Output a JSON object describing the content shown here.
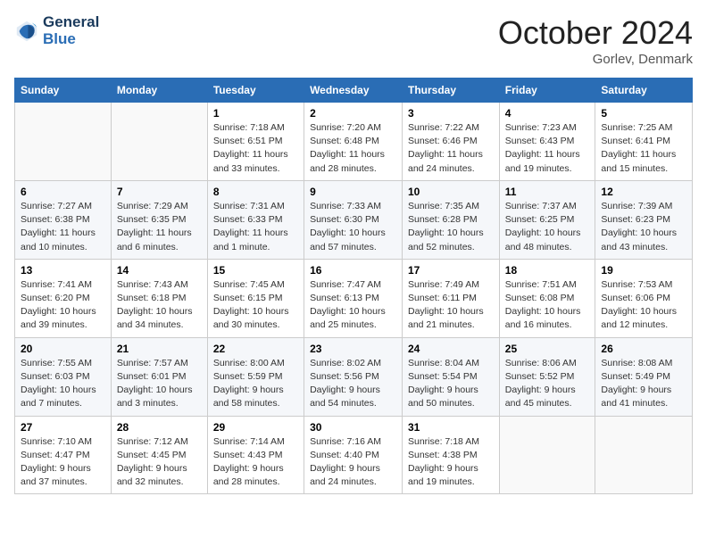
{
  "logo": {
    "line1": "General",
    "line2": "Blue"
  },
  "title": "October 2024",
  "location": "Gorlev, Denmark",
  "days_of_week": [
    "Sunday",
    "Monday",
    "Tuesday",
    "Wednesday",
    "Thursday",
    "Friday",
    "Saturday"
  ],
  "weeks": [
    [
      {
        "num": "",
        "detail": ""
      },
      {
        "num": "",
        "detail": ""
      },
      {
        "num": "1",
        "detail": "Sunrise: 7:18 AM\nSunset: 6:51 PM\nDaylight: 11 hours\nand 33 minutes."
      },
      {
        "num": "2",
        "detail": "Sunrise: 7:20 AM\nSunset: 6:48 PM\nDaylight: 11 hours\nand 28 minutes."
      },
      {
        "num": "3",
        "detail": "Sunrise: 7:22 AM\nSunset: 6:46 PM\nDaylight: 11 hours\nand 24 minutes."
      },
      {
        "num": "4",
        "detail": "Sunrise: 7:23 AM\nSunset: 6:43 PM\nDaylight: 11 hours\nand 19 minutes."
      },
      {
        "num": "5",
        "detail": "Sunrise: 7:25 AM\nSunset: 6:41 PM\nDaylight: 11 hours\nand 15 minutes."
      }
    ],
    [
      {
        "num": "6",
        "detail": "Sunrise: 7:27 AM\nSunset: 6:38 PM\nDaylight: 11 hours\nand 10 minutes."
      },
      {
        "num": "7",
        "detail": "Sunrise: 7:29 AM\nSunset: 6:35 PM\nDaylight: 11 hours\nand 6 minutes."
      },
      {
        "num": "8",
        "detail": "Sunrise: 7:31 AM\nSunset: 6:33 PM\nDaylight: 11 hours\nand 1 minute."
      },
      {
        "num": "9",
        "detail": "Sunrise: 7:33 AM\nSunset: 6:30 PM\nDaylight: 10 hours\nand 57 minutes."
      },
      {
        "num": "10",
        "detail": "Sunrise: 7:35 AM\nSunset: 6:28 PM\nDaylight: 10 hours\nand 52 minutes."
      },
      {
        "num": "11",
        "detail": "Sunrise: 7:37 AM\nSunset: 6:25 PM\nDaylight: 10 hours\nand 48 minutes."
      },
      {
        "num": "12",
        "detail": "Sunrise: 7:39 AM\nSunset: 6:23 PM\nDaylight: 10 hours\nand 43 minutes."
      }
    ],
    [
      {
        "num": "13",
        "detail": "Sunrise: 7:41 AM\nSunset: 6:20 PM\nDaylight: 10 hours\nand 39 minutes."
      },
      {
        "num": "14",
        "detail": "Sunrise: 7:43 AM\nSunset: 6:18 PM\nDaylight: 10 hours\nand 34 minutes."
      },
      {
        "num": "15",
        "detail": "Sunrise: 7:45 AM\nSunset: 6:15 PM\nDaylight: 10 hours\nand 30 minutes."
      },
      {
        "num": "16",
        "detail": "Sunrise: 7:47 AM\nSunset: 6:13 PM\nDaylight: 10 hours\nand 25 minutes."
      },
      {
        "num": "17",
        "detail": "Sunrise: 7:49 AM\nSunset: 6:11 PM\nDaylight: 10 hours\nand 21 minutes."
      },
      {
        "num": "18",
        "detail": "Sunrise: 7:51 AM\nSunset: 6:08 PM\nDaylight: 10 hours\nand 16 minutes."
      },
      {
        "num": "19",
        "detail": "Sunrise: 7:53 AM\nSunset: 6:06 PM\nDaylight: 10 hours\nand 12 minutes."
      }
    ],
    [
      {
        "num": "20",
        "detail": "Sunrise: 7:55 AM\nSunset: 6:03 PM\nDaylight: 10 hours\nand 7 minutes."
      },
      {
        "num": "21",
        "detail": "Sunrise: 7:57 AM\nSunset: 6:01 PM\nDaylight: 10 hours\nand 3 minutes."
      },
      {
        "num": "22",
        "detail": "Sunrise: 8:00 AM\nSunset: 5:59 PM\nDaylight: 9 hours\nand 58 minutes."
      },
      {
        "num": "23",
        "detail": "Sunrise: 8:02 AM\nSunset: 5:56 PM\nDaylight: 9 hours\nand 54 minutes."
      },
      {
        "num": "24",
        "detail": "Sunrise: 8:04 AM\nSunset: 5:54 PM\nDaylight: 9 hours\nand 50 minutes."
      },
      {
        "num": "25",
        "detail": "Sunrise: 8:06 AM\nSunset: 5:52 PM\nDaylight: 9 hours\nand 45 minutes."
      },
      {
        "num": "26",
        "detail": "Sunrise: 8:08 AM\nSunset: 5:49 PM\nDaylight: 9 hours\nand 41 minutes."
      }
    ],
    [
      {
        "num": "27",
        "detail": "Sunrise: 7:10 AM\nSunset: 4:47 PM\nDaylight: 9 hours\nand 37 minutes."
      },
      {
        "num": "28",
        "detail": "Sunrise: 7:12 AM\nSunset: 4:45 PM\nDaylight: 9 hours\nand 32 minutes."
      },
      {
        "num": "29",
        "detail": "Sunrise: 7:14 AM\nSunset: 4:43 PM\nDaylight: 9 hours\nand 28 minutes."
      },
      {
        "num": "30",
        "detail": "Sunrise: 7:16 AM\nSunset: 4:40 PM\nDaylight: 9 hours\nand 24 minutes."
      },
      {
        "num": "31",
        "detail": "Sunrise: 7:18 AM\nSunset: 4:38 PM\nDaylight: 9 hours\nand 19 minutes."
      },
      {
        "num": "",
        "detail": ""
      },
      {
        "num": "",
        "detail": ""
      }
    ]
  ]
}
